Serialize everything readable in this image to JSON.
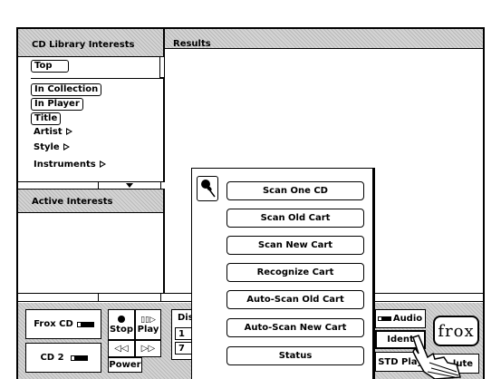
{
  "left_panel": {
    "header": "CD Library Interests",
    "top_label": "Top",
    "items": [
      {
        "label": "In Collection"
      },
      {
        "label": "In Player"
      },
      {
        "label": "Title"
      },
      {
        "label": "Artist"
      },
      {
        "label": "Style"
      },
      {
        "label": "Instruments"
      }
    ],
    "active_header": "Active Interests"
  },
  "results": {
    "header": "Results"
  },
  "popup": {
    "items": [
      "Scan One CD",
      "Scan Old Cart",
      "Scan New Cart",
      "Recognize Cart",
      "Auto-Scan Old Cart",
      "Auto-Scan New Cart",
      "Status"
    ]
  },
  "controls": {
    "frox_cd": "Frox CD",
    "cd2": "CD 2",
    "stop": "Stop",
    "play": "Play",
    "power": "Power",
    "disc_label": "Dis",
    "disc_numbers": [
      "1",
      "7"
    ],
    "audio": "Audio",
    "ident": "Ident",
    "std_play": "STD Play",
    "mute": "lute",
    "logo": "frox"
  }
}
